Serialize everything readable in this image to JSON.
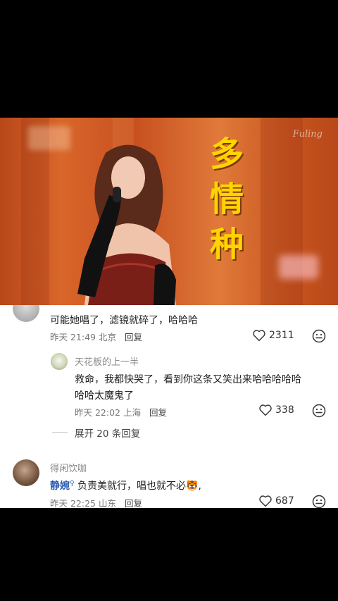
{
  "video": {
    "overlay_text": [
      "多",
      "情",
      "种"
    ],
    "watermark": "Fuling"
  },
  "comments": [
    {
      "text": "可能她唱了，滤镜就碎了，哈哈哈",
      "time": "昨天 21:49",
      "location": "北京",
      "reply_label": "回复",
      "likes": "2311"
    },
    {
      "author": "天花板的上一半",
      "text_line1": "救命，我都快哭了，看到你这条又笑出来哈哈哈哈哈",
      "text_line2": "哈哈太魔鬼了",
      "time": "昨天 22:02",
      "location": "上海",
      "reply_label": "回复",
      "likes": "338"
    },
    {
      "expand_label": "展开 20 条回复"
    },
    {
      "author": "得闲饮咖",
      "mention": "静婉",
      "mention_badge": "♀",
      "text": " 负责美就行，唱也就不必",
      "emoji": "🐯",
      "text_end": ",",
      "time": "昨天 22:25",
      "location": "山东",
      "reply_label": "回复",
      "likes": "687"
    }
  ],
  "colors": {
    "background": "#000000",
    "overlay_text": "#ffd400",
    "mention": "#2f5db5",
    "comment_bg": "#ffffff"
  },
  "icons": [
    "heart-icon",
    "emoji-face-icon"
  ]
}
